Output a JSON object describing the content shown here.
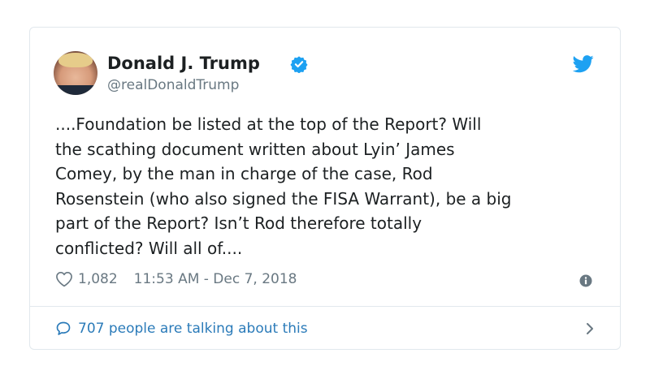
{
  "tweet": {
    "author_name": "Donald J. Trump",
    "handle": "@realDonaldTrump",
    "verified": true,
    "text_lines": [
      "....Foundation be listed at the top of the Report? Will",
      "the scathing document written about Lyin’ James",
      "Comey, by the man in charge of the case, Rod",
      "Rosenstein (who also signed the FISA Warrant), be a big",
      "part of the Report? Isn’t Rod therefore totally",
      "conflicted? Will all of...."
    ],
    "likes": "1,082",
    "timestamp": "11:53 AM - Dec 7, 2018",
    "conversation_label": "707 people are talking about this"
  },
  "colors": {
    "brand_blue": "#1da1f2",
    "link_blue": "#2b7bb9",
    "meta_gray": "#697882",
    "border": "#e1e8ed"
  },
  "icons": {
    "verified": "verified-badge-icon",
    "brand": "twitter-bird-icon",
    "like": "heart-icon",
    "info": "info-icon",
    "reply": "speech-bubble-icon",
    "more": "chevron-right-icon"
  }
}
